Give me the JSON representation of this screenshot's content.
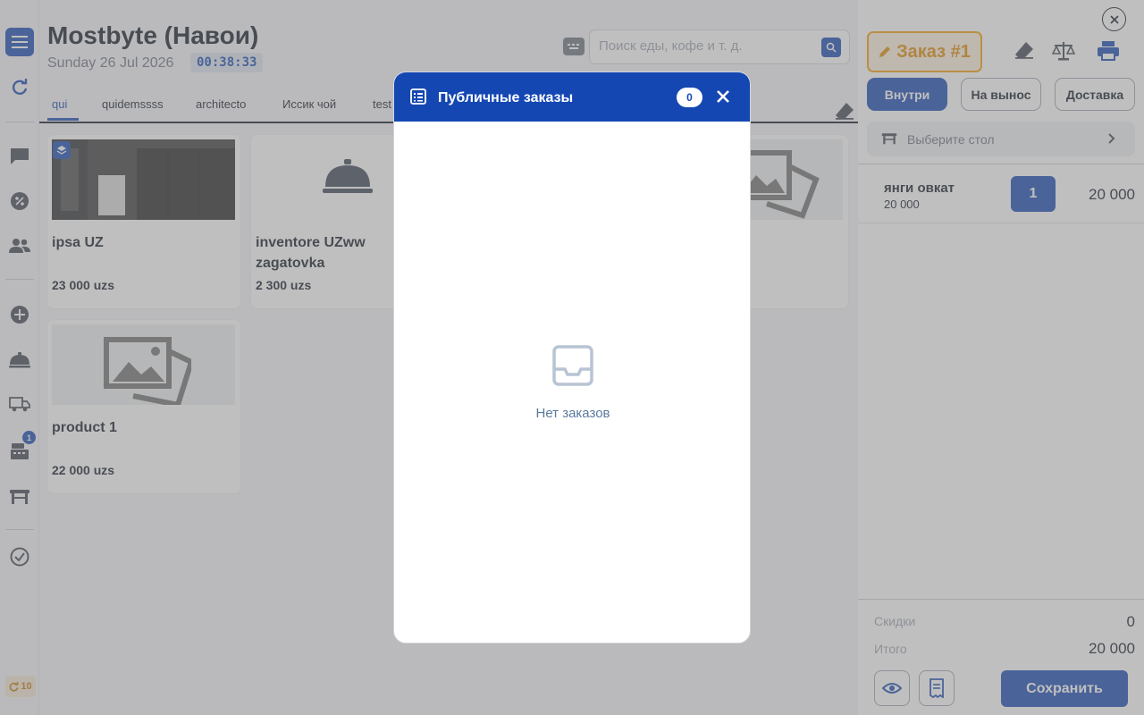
{
  "header": {
    "title": "Mostbyte (Навои)",
    "date": "Sunday 26 Jul 2026",
    "time": "00:38:33",
    "search_placeholder": "Поиск еды, кофе и т. д."
  },
  "sidebar": {
    "notification_count": "1",
    "counter": "10"
  },
  "tabs": [
    {
      "label": "qui",
      "active": true
    },
    {
      "label": "quidemssss"
    },
    {
      "label": "architecto"
    },
    {
      "label": "Иссик чой"
    },
    {
      "label": "test"
    }
  ],
  "products": [
    {
      "name": "ipsa UZ",
      "price": "23 000 uzs"
    },
    {
      "name": "inventore UZww zagatovka",
      "price": "2 300 uzs"
    },
    {
      "name": "product 1",
      "price": "22 000 uzs"
    }
  ],
  "order_panel": {
    "order_label": "Заказ #1",
    "order_types": [
      "Внутри",
      "На вынос",
      "Доставка"
    ],
    "table_placeholder": "Выберите стол",
    "item": {
      "name": "янги овкат",
      "unit_price": "20 000",
      "qty": "1",
      "total": "20 000"
    },
    "discount_label": "Скидки",
    "discount_value": "0",
    "total_label": "Итого",
    "total_value": "20 000",
    "save_label": "Сохранить"
  },
  "modal": {
    "title": "Публичные заказы",
    "count": "0",
    "empty_text": "Нет заказов"
  },
  "colors": {
    "primary": "#1547b3",
    "accent_orange": "#e08a06"
  }
}
